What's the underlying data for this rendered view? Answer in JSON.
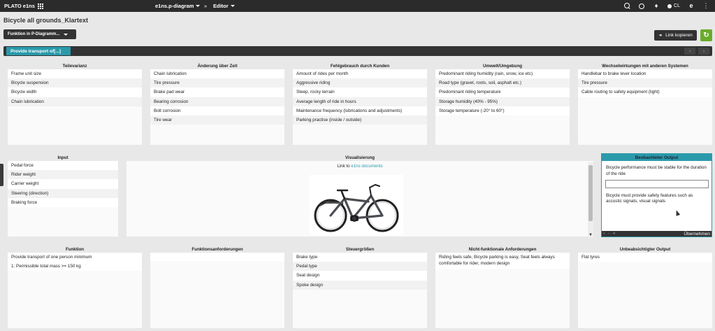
{
  "topbar": {
    "brand": "PLATO e1ns",
    "menu_diagram": "e1ns.p-diagram",
    "menu_separator": "»",
    "menu_editor": "Editor",
    "user_initials": "CL",
    "icons": [
      "search-icon",
      "clock-icon",
      "bell-icon",
      "user-icon",
      "e1ns-icon",
      "info-icon"
    ]
  },
  "page": {
    "title": "Bicycle all grounds_Klartext",
    "function_select": "Funktion in P-Diagramm...",
    "link_button": "Link kopieren"
  },
  "tabs": {
    "active": "Provide transport of[...]",
    "prev": "‹",
    "next": "›"
  },
  "panels": {
    "teilevarianz": {
      "title": "Teilevarianz",
      "items": [
        "Frame unit size",
        "Bicycle suspension",
        "Bicycle width",
        "Chain lubrication"
      ]
    },
    "aenderung": {
      "title": "Änderung über Zeit",
      "items": [
        "Chain lubrication",
        "Tire pressure",
        "Brake pad wear",
        "Bearing corrosion",
        "Bolt corrosion",
        "Tire wear"
      ]
    },
    "fehlgebrauch": {
      "title": "Fehlgebrauch durch Kunden",
      "items": [
        "Amount of rides per month",
        "Aggressive riding",
        "Steep, rocky terrain",
        "Average length of ride in hours",
        "Maintenance frequency (lubrications and adjustments)",
        "Parking practise (inside / outside)"
      ]
    },
    "umwelt": {
      "title": "Umwelt/Umgebung",
      "items": [
        "Predominant riding humidity (rain, snow, ice etc)",
        "Road type (gravel, roots, soil, asphalt etc.)",
        "Predominant riding temperature",
        "Storage humidity (40% - 95%)",
        "Storage temperature (-20° to 60°)"
      ]
    },
    "wechselwirkungen": {
      "title": "Wechselwirkungen mit anderen Systemen",
      "items": [
        "Handlebar to brake lever location",
        "Tire pressure",
        "Cable routing to safety equipment (light)"
      ]
    },
    "input": {
      "title": "Input",
      "items": [
        "Pedal force",
        "Rider weight",
        "Carrier weight",
        "Steering (direction)",
        "Braking force"
      ]
    },
    "visualisierung": {
      "title": "Visualisierung",
      "link_prefix": "Link to",
      "link_text": "e1ns documents"
    },
    "beobachteter": {
      "title": "Beobachteter Output",
      "text1": "Bicycle performance must be stable for the duration of the ride",
      "input_value": "",
      "text2": "Bicycle must provide safety features such as accustic signals, visual signals",
      "apply": "Übernehmen"
    },
    "funktion": {
      "title": "Funktion",
      "items": [
        "Provide transport of one person minimum",
        "1: Permissible total mass >= 150 kg"
      ]
    },
    "funktionsanforderungen": {
      "title": "Funktionsanforderungen",
      "items": []
    },
    "steuergroessen": {
      "title": "Steuergrößen",
      "items": [
        "Brake type",
        "Pedal type",
        "Seat design",
        "Spoke design"
      ]
    },
    "nichtfunktional": {
      "title": "Nicht-funktionale Anforderungen",
      "text": "Riding feels safe, Bicycle parking is easy, Seat feels always comfortable for rider, modern design"
    },
    "unbeabsichtigter": {
      "title": "Unbeabsichtigter Output",
      "items": [
        "Flat tyres"
      ]
    }
  },
  "colors": {
    "accent": "#2a9aab",
    "topbar": "#2b2b2b",
    "refresh": "#6aab2a"
  }
}
